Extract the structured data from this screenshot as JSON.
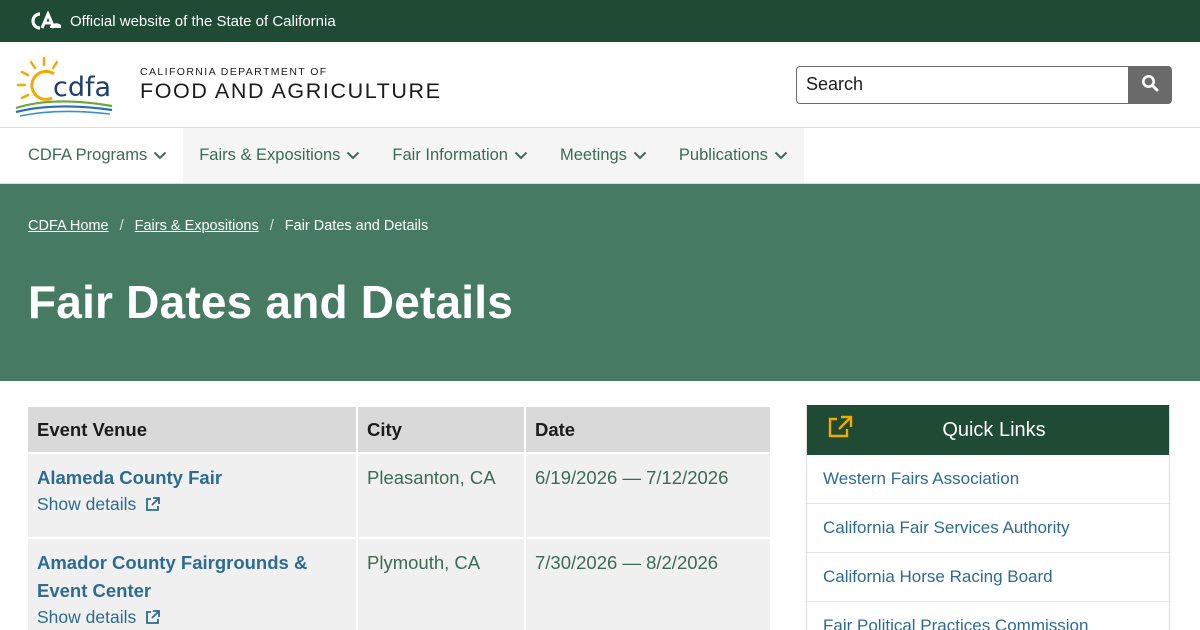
{
  "utility_bar": {
    "logo_text": "CA",
    "text": "Official website of the State of California"
  },
  "header": {
    "logo_text": "cdfa",
    "dept_small": "CALIFORNIA DEPARTMENT OF",
    "dept_big": "FOOD AND AGRICULTURE",
    "search_placeholder": "Search"
  },
  "nav": {
    "items": [
      {
        "label": "CDFA Programs"
      },
      {
        "label": "Fairs & Expositions"
      },
      {
        "label": "Fair Information"
      },
      {
        "label": "Meetings"
      },
      {
        "label": "Publications"
      }
    ]
  },
  "breadcrumb": {
    "items": [
      "CDFA Home",
      "Fairs & Expositions"
    ],
    "current": "Fair Dates and Details"
  },
  "page": {
    "title": "Fair Dates and Details"
  },
  "table": {
    "headers": [
      "Event Venue",
      "City",
      "Date"
    ],
    "rows": [
      {
        "venue": "Alameda County Fair",
        "details": "Show details",
        "city": "Pleasanton, CA",
        "date": "6/19/2026 — 7/12/2026"
      },
      {
        "venue": "Amador County Fairgrounds & Event Center",
        "details": "Show details",
        "city": "Plymouth, CA",
        "date": "7/30/2026 — 8/2/2026"
      }
    ]
  },
  "quick_links": {
    "title": "Quick Links",
    "items": [
      "Western Fairs Association",
      "California Fair Services Authority",
      "California Horse Racing Board",
      "Fair Political Practices Commission"
    ]
  },
  "colors": {
    "dark_green": "#1f4a33",
    "hero_green": "#477a62",
    "link_blue": "#2d6b91",
    "accent_gold": "#f2a900"
  },
  "icons": [
    "ca-logo-icon",
    "cdfa-sun-logo",
    "search-icon",
    "chevron-down-icon",
    "external-link-icon"
  ]
}
